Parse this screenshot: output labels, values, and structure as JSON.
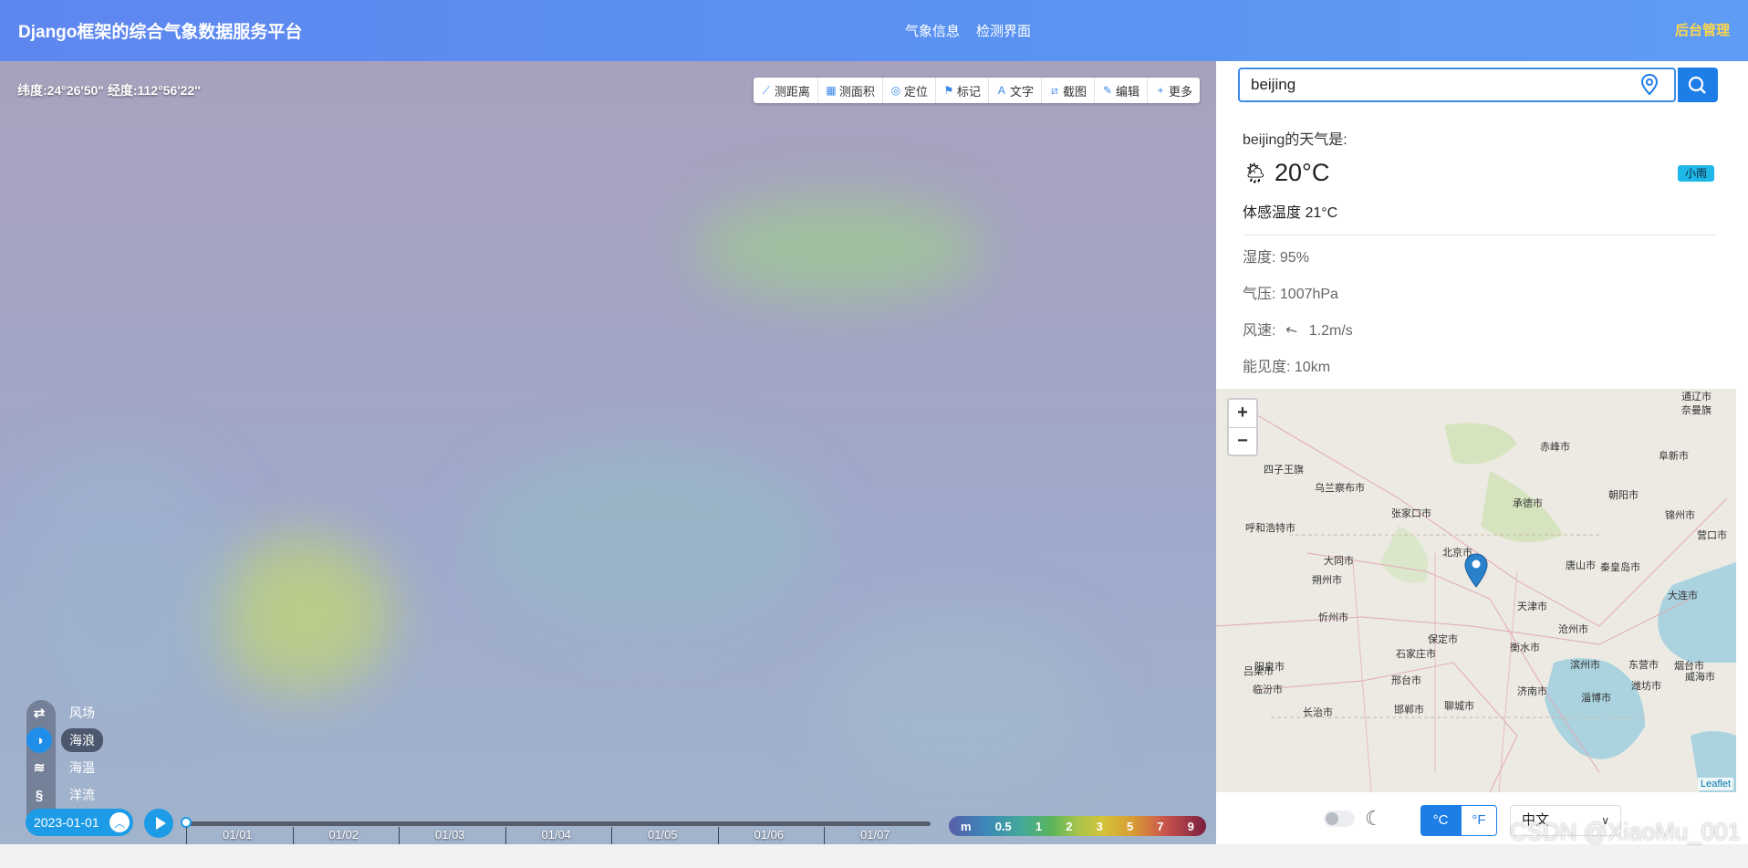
{
  "header": {
    "title": "Django框架的综合气象数据服务平台",
    "nav": [
      "气象信息",
      "检测界面"
    ],
    "admin": "后台管理"
  },
  "map": {
    "coords": "纬度:24°26'50\"  经度:112°56'22\"",
    "toolbar": [
      "测距离",
      "测面积",
      "定位",
      "标记",
      "文字",
      "截图",
      "编辑",
      "更多"
    ],
    "layers": [
      {
        "label": "风场",
        "icon": "wind-icon"
      },
      {
        "label": "海浪",
        "icon": "wave-icon"
      },
      {
        "label": "海温",
        "icon": "sea-temp-icon"
      },
      {
        "label": "洋流",
        "icon": "current-icon"
      }
    ],
    "active_layer": "海浪",
    "date": "2023-01-01",
    "timeline_ticks": [
      "01/01",
      "01/02",
      "01/03",
      "01/04",
      "01/05",
      "01/06",
      "01/07"
    ],
    "timeline_progress": 0.0,
    "legend": [
      "m",
      "0.5",
      "1",
      "2",
      "3",
      "5",
      "7",
      "9"
    ]
  },
  "side": {
    "search_value": "beijing",
    "weather_heading": "beijing的天气是:",
    "weather_icon": "rain-cloud-icon",
    "temperature": "20°C",
    "condition_badge": "小雨",
    "feels_like": "体感温度 21°C",
    "humidity": "湿度: 95%",
    "pressure": "气压: 1007hPa",
    "wind_label": "风速:",
    "wind_value": "1.2m/s",
    "visibility": "能见度: 10km",
    "minimap": {
      "zoom_in": "+",
      "zoom_out": "−",
      "attribution": "Leaflet",
      "cities": [
        "通辽市",
        "奈曼旗",
        "赤峰市",
        "阜新市",
        "四子王旗",
        "乌兰察布市",
        "张家口市",
        "承德市",
        "朝阳市",
        "锦州市",
        "营口市",
        "呼和浩特市",
        "北京市",
        "大同市",
        "唐山市",
        "秦皇岛市",
        "朔州市",
        "天津市",
        "保定市",
        "沧州市",
        "忻州市",
        "石家庄市",
        "阳泉市",
        "衡水市",
        "济南市",
        "滨州市",
        "东营市",
        "大连市",
        "烟台市",
        "威海市",
        "邯郸市",
        "聊城市",
        "长治市",
        "临汾市",
        "淄博市",
        "潍坊市",
        "吕梁市",
        "邢台市"
      ]
    },
    "unit_c": "°C",
    "unit_f": "°F",
    "language": "中文"
  },
  "watermark": "CSDN @XiaoMu_001",
  "colors": {
    "header_start": "#5e86ef",
    "header_end": "#5f9cf5",
    "accent": "#1e7ee8",
    "badge": "#1db8e8"
  }
}
